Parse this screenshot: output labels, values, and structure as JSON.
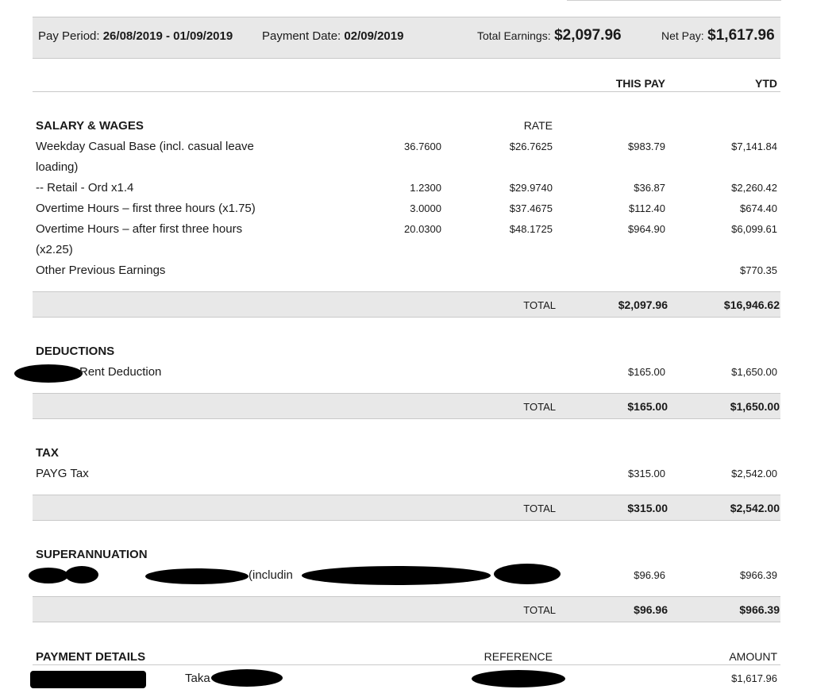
{
  "header": {
    "pay_period_label": "Pay Period:",
    "pay_period_value": "26/08/2019 - 01/09/2019",
    "payment_date_label": "Payment Date:",
    "payment_date_value": "02/09/2019",
    "total_earnings_label": "Total Earnings:",
    "total_earnings_value": "$2,097.96",
    "net_pay_label": "Net Pay:",
    "net_pay_value": "$1,617.96"
  },
  "columns": {
    "this_pay": "THIS PAY",
    "ytd": "YTD",
    "rate": "RATE"
  },
  "salary": {
    "title": "SALARY & WAGES",
    "rows": [
      {
        "desc_1": "Weekday Casual Base (incl. casual leave",
        "desc_2": "loading)",
        "hours": "36.7600",
        "rate": "$26.7625",
        "this_pay": "$983.79",
        "ytd": "$7,141.84"
      },
      {
        "desc_1": "-- Retail - Ord x1.4",
        "hours": "1.2300",
        "rate": "$29.9740",
        "this_pay": "$36.87",
        "ytd": "$2,260.42"
      },
      {
        "desc_1": "Overtime Hours – first three hours (x1.75)",
        "hours": "3.0000",
        "rate": "$37.4675",
        "this_pay": "$112.40",
        "ytd": "$674.40"
      },
      {
        "desc_1": "Overtime Hours – after first three hours",
        "desc_2": "(x2.25)",
        "hours": "20.0300",
        "rate": "$48.1725",
        "this_pay": "$964.90",
        "ytd": "$6,099.61"
      },
      {
        "desc_1": "Other Previous Earnings",
        "ytd": "$770.35"
      }
    ],
    "total_label": "TOTAL",
    "total_this_pay": "$2,097.96",
    "total_ytd": "$16,946.62"
  },
  "deductions": {
    "title": "DEDUCTIONS",
    "row": {
      "desc": "Rent Deduction",
      "this_pay": "$165.00",
      "ytd": "$1,650.00"
    },
    "total_label": "TOTAL",
    "total_this_pay": "$165.00",
    "total_ytd": "$1,650.00"
  },
  "tax": {
    "title": "TAX",
    "row": {
      "desc": "PAYG Tax",
      "this_pay": "$315.00",
      "ytd": "$2,542.00"
    },
    "total_label": "TOTAL",
    "total_this_pay": "$315.00",
    "total_ytd": "$2,542.00"
  },
  "super": {
    "title": "SUPERANNUATION",
    "row": {
      "desc_visible": "(includin",
      "this_pay": "$96.96",
      "ytd": "$966.39"
    },
    "total_label": "TOTAL",
    "total_this_pay": "$96.96",
    "total_ytd": "$966.39"
  },
  "payment": {
    "title": "PAYMENT DETAILS",
    "reference_label": "REFERENCE",
    "amount_label": "AMOUNT",
    "row": {
      "name_visible": "Taka",
      "amount": "$1,617.96"
    }
  },
  "colors": {
    "band": "#e8e8e8",
    "rule": "#c9c9c9",
    "text": "#1a1a1a",
    "redaction": "#000000"
  }
}
